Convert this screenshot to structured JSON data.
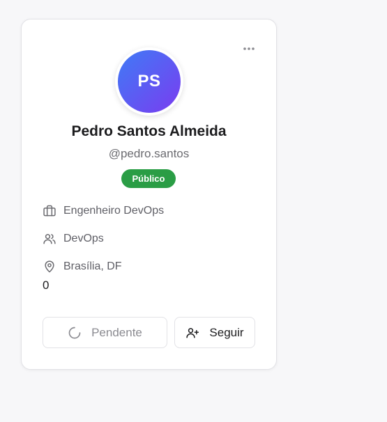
{
  "profile": {
    "initials": "PS",
    "name": "Pedro Santos Almeida",
    "handle": "@pedro.santos",
    "visibility": "Público",
    "job_title": "Engenheiro DevOps",
    "team": "DevOps",
    "location": "Brasília, DF",
    "count": "0"
  },
  "actions": {
    "pending_label": "Pendente",
    "follow_label": "Seguir"
  },
  "icons": {
    "more": "more-horizontal-icon",
    "job": "briefcase-icon",
    "team": "users-icon",
    "location": "map-pin-icon",
    "pending": "spinner-icon",
    "follow": "user-plus-icon"
  },
  "colors": {
    "avatar_gradient_start": "#3f7bf6",
    "avatar_gradient_end": "#7a3cf0",
    "badge_green": "#2a9d45"
  }
}
